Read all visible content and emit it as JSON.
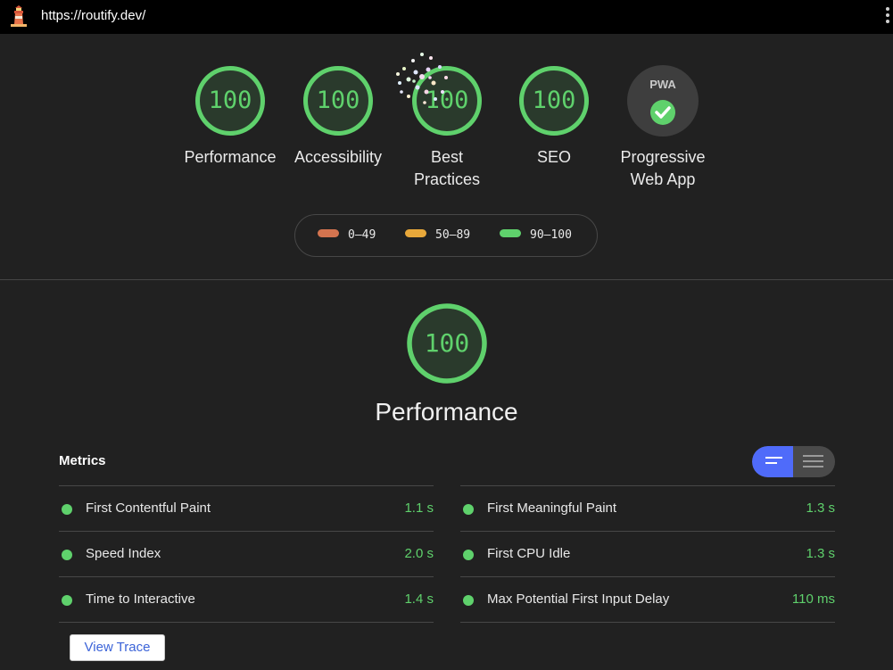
{
  "header": {
    "url": "https://routify.dev/",
    "logo_icon": "lighthouse-icon",
    "menu_icon": "more-vert-icon"
  },
  "categories": [
    {
      "label": "Performance",
      "score": "100"
    },
    {
      "label": "Accessibility",
      "score": "100"
    },
    {
      "label": "Best Practices",
      "score": "100"
    },
    {
      "label": "SEO",
      "score": "100"
    },
    {
      "label": "Progressive Web App",
      "badge": "PWA",
      "badge_icon": "check-badge-icon"
    }
  ],
  "legend": [
    {
      "range": "0–49",
      "color": "#d4744f"
    },
    {
      "range": "50–89",
      "color": "#e8a83a"
    },
    {
      "range": "90–100",
      "color": "#5fd16c"
    }
  ],
  "performance": {
    "score": "100",
    "title": "Performance",
    "metrics_label": "Metrics",
    "view_trace": "View Trace",
    "metrics_left": [
      {
        "name": "First Contentful Paint",
        "value": "1.1 s"
      },
      {
        "name": "Speed Index",
        "value": "2.0 s"
      },
      {
        "name": "Time to Interactive",
        "value": "1.4 s"
      }
    ],
    "metrics_right": [
      {
        "name": "First Meaningful Paint",
        "value": "1.3 s"
      },
      {
        "name": "First CPU Idle",
        "value": "1.3 s"
      },
      {
        "name": "Max Potential First Input Delay",
        "value": "110 ms"
      }
    ]
  },
  "colors": {
    "pass": "#5fd16c",
    "background": "#212121",
    "toggle_active": "#4f6bfa"
  }
}
